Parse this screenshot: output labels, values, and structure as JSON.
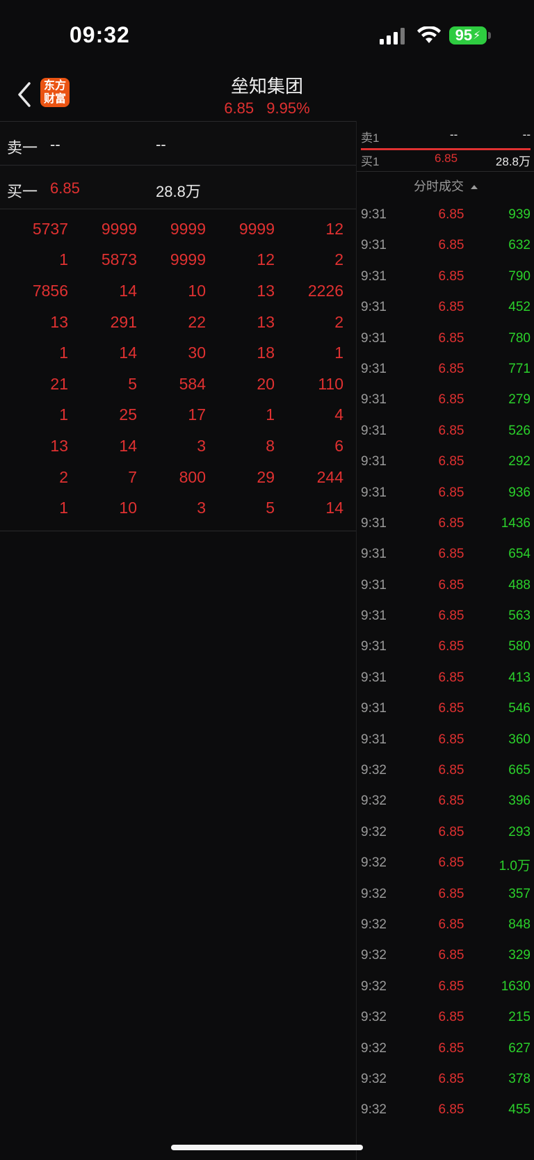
{
  "status_bar": {
    "time": "09:32",
    "battery": "95"
  },
  "header": {
    "logo_text": "东方财富",
    "title": "垒知集团",
    "price": "6.85",
    "change_pct": "9.95%"
  },
  "quotes": {
    "sell": {
      "label": "卖一",
      "price": "--",
      "volume": "--"
    },
    "buy": {
      "label": "买一",
      "price": "6.85",
      "volume": "28.8万"
    }
  },
  "queue_grid": [
    [
      "5737",
      "9999",
      "9999",
      "9999",
      "12"
    ],
    [
      "1",
      "5873",
      "9999",
      "12",
      "2"
    ],
    [
      "7856",
      "14",
      "10",
      "13",
      "2226"
    ],
    [
      "13",
      "291",
      "22",
      "13",
      "2"
    ],
    [
      "1",
      "14",
      "30",
      "18",
      "1"
    ],
    [
      "21",
      "5",
      "584",
      "20",
      "110"
    ],
    [
      "1",
      "25",
      "17",
      "1",
      "4"
    ],
    [
      "13",
      "14",
      "3",
      "8",
      "6"
    ],
    [
      "2",
      "7",
      "800",
      "29",
      "244"
    ],
    [
      "1",
      "10",
      "3",
      "5",
      "14"
    ]
  ],
  "right_quotes": {
    "sell": {
      "label": "卖1",
      "price": "--",
      "volume": "--"
    },
    "buy": {
      "label": "买1",
      "price": "6.85",
      "volume": "28.8万"
    }
  },
  "ticks_header": "分时成交",
  "ticks": [
    {
      "time": "9:31",
      "price": "6.85",
      "volume": "939"
    },
    {
      "time": "9:31",
      "price": "6.85",
      "volume": "632"
    },
    {
      "time": "9:31",
      "price": "6.85",
      "volume": "790"
    },
    {
      "time": "9:31",
      "price": "6.85",
      "volume": "452"
    },
    {
      "time": "9:31",
      "price": "6.85",
      "volume": "780"
    },
    {
      "time": "9:31",
      "price": "6.85",
      "volume": "771"
    },
    {
      "time": "9:31",
      "price": "6.85",
      "volume": "279"
    },
    {
      "time": "9:31",
      "price": "6.85",
      "volume": "526"
    },
    {
      "time": "9:31",
      "price": "6.85",
      "volume": "292"
    },
    {
      "time": "9:31",
      "price": "6.85",
      "volume": "936"
    },
    {
      "time": "9:31",
      "price": "6.85",
      "volume": "1436"
    },
    {
      "time": "9:31",
      "price": "6.85",
      "volume": "654"
    },
    {
      "time": "9:31",
      "price": "6.85",
      "volume": "488"
    },
    {
      "time": "9:31",
      "price": "6.85",
      "volume": "563"
    },
    {
      "time": "9:31",
      "price": "6.85",
      "volume": "580"
    },
    {
      "time": "9:31",
      "price": "6.85",
      "volume": "413"
    },
    {
      "time": "9:31",
      "price": "6.85",
      "volume": "546"
    },
    {
      "time": "9:31",
      "price": "6.85",
      "volume": "360"
    },
    {
      "time": "9:32",
      "price": "6.85",
      "volume": "665"
    },
    {
      "time": "9:32",
      "price": "6.85",
      "volume": "396"
    },
    {
      "time": "9:32",
      "price": "6.85",
      "volume": "293"
    },
    {
      "time": "9:32",
      "price": "6.85",
      "volume": "1.0万"
    },
    {
      "time": "9:32",
      "price": "6.85",
      "volume": "357"
    },
    {
      "time": "9:32",
      "price": "6.85",
      "volume": "848"
    },
    {
      "time": "9:32",
      "price": "6.85",
      "volume": "329"
    },
    {
      "time": "9:32",
      "price": "6.85",
      "volume": "1630"
    },
    {
      "time": "9:32",
      "price": "6.85",
      "volume": "215"
    },
    {
      "time": "9:32",
      "price": "6.85",
      "volume": "627"
    },
    {
      "time": "9:32",
      "price": "6.85",
      "volume": "378"
    },
    {
      "time": "9:32",
      "price": "6.85",
      "volume": "455"
    }
  ]
}
